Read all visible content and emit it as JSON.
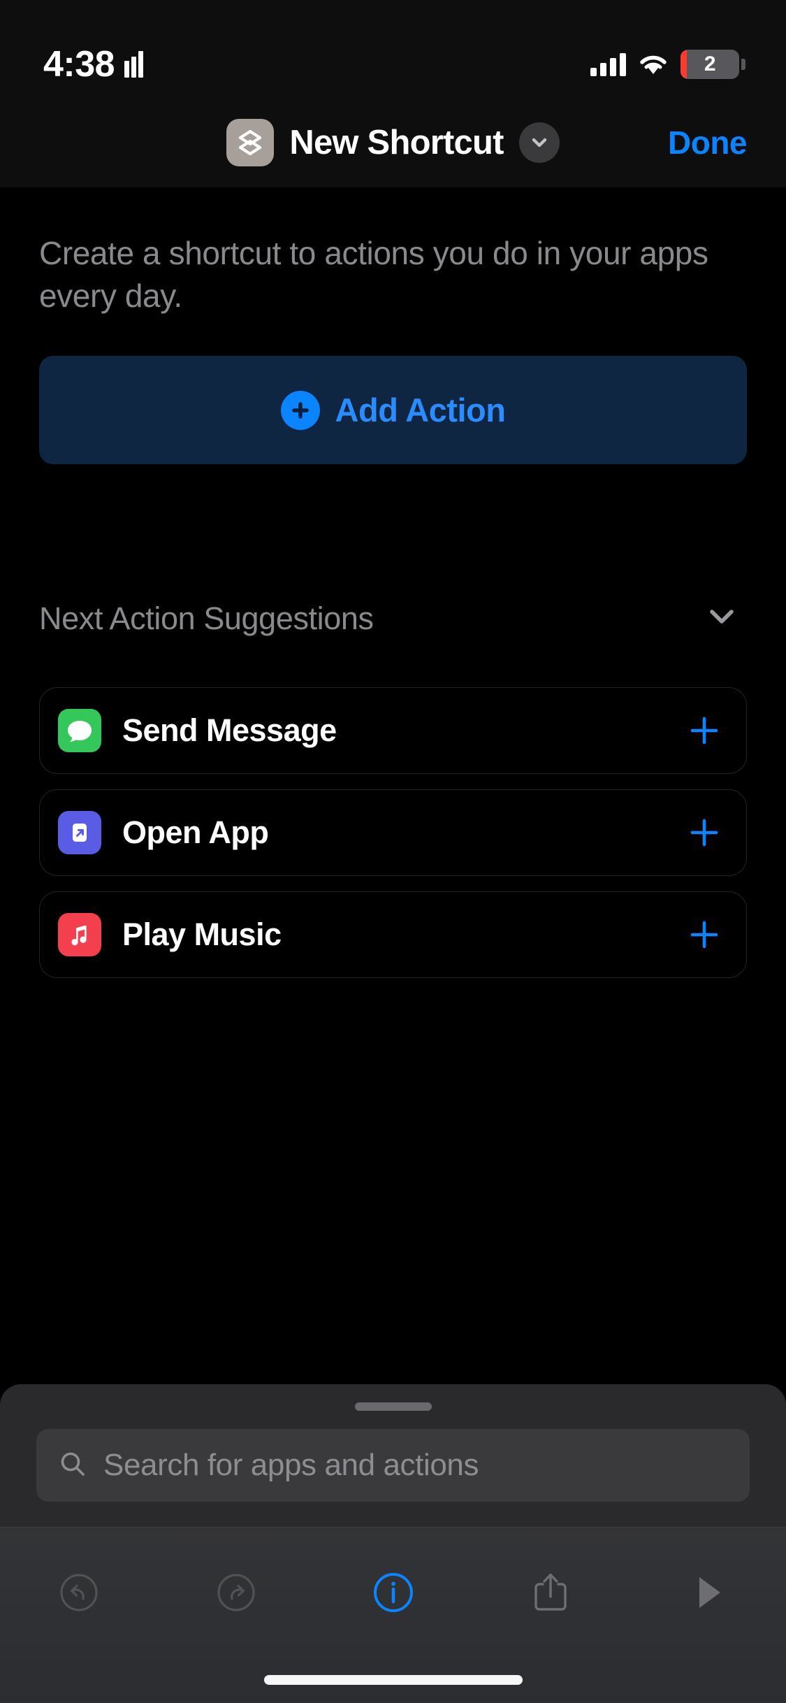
{
  "status_bar": {
    "time": "4:38",
    "recording_icon": "audio-bars-icon",
    "signal_icon": "cellular-signal-icon",
    "wifi_icon": "wifi-icon",
    "battery_percent": "2",
    "battery_low_color": "#ff3b30"
  },
  "nav_bar": {
    "app_glyph_icon": "shortcut-layers-icon",
    "app_glyph_bg": "#a79f99",
    "title": "New Shortcut",
    "chevron_icon": "chevron-down-icon",
    "done_label": "Done",
    "done_color": "#0a84ff"
  },
  "main": {
    "intro_text": "Create a shortcut to actions you do in your apps every day.",
    "add_action": {
      "label": "Add Action",
      "icon": "plus-circle-icon",
      "background": "#0f2643",
      "text_color": "#2b8cff"
    },
    "suggestions": {
      "title": "Next Action Suggestions",
      "collapse_icon": "chevron-down-icon",
      "rows": [
        {
          "label": "Send Message",
          "icon": "messages-icon",
          "icon_bg": "#34c759",
          "add_icon": "plus-icon"
        },
        {
          "label": "Open App",
          "icon": "open-app-icon",
          "icon_bg": "#5a5ce6",
          "add_icon": "plus-icon"
        },
        {
          "label": "Play Music",
          "icon": "music-icon",
          "icon_bg": "#f4404e",
          "add_icon": "plus-icon"
        }
      ]
    }
  },
  "bottom_sheet": {
    "grabber": "sheet-grabber",
    "search": {
      "icon": "search-icon",
      "placeholder": "Search for apps and actions",
      "value": ""
    }
  },
  "toolbar": {
    "buttons": [
      {
        "name": "undo",
        "icon": "undo-icon",
        "color": "#5a5a5d"
      },
      {
        "name": "redo",
        "icon": "redo-icon",
        "color": "#5a5a5d"
      },
      {
        "name": "info",
        "icon": "info-circle-icon",
        "color": "#0a84ff"
      },
      {
        "name": "share",
        "icon": "share-icon",
        "color": "#6e6e72"
      },
      {
        "name": "run",
        "icon": "play-icon",
        "color": "#6e6e72"
      }
    ]
  }
}
